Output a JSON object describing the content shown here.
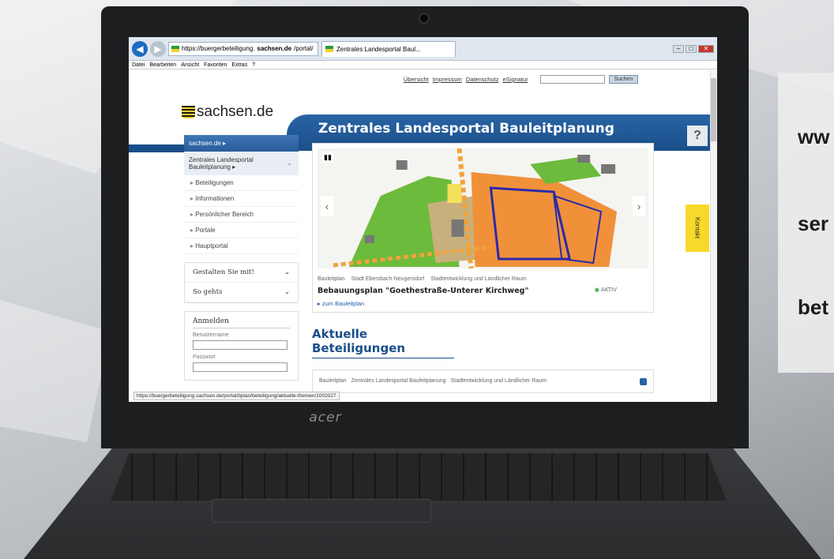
{
  "browser": {
    "url_prefix": "https://buergerbeteiligung.",
    "url_domain": "sachsen.de",
    "url_suffix": "/portal/",
    "tab_title": "Zentrales Landesportal Baul...",
    "menu": [
      "Datei",
      "Bearbeiten",
      "Ansicht",
      "Favoriten",
      "Extras",
      "?"
    ],
    "status_url": "https://buergerbeteiligung.sachsen.de/portal/bplan/beteiligung/aktuelle-themen/1002027"
  },
  "toplinks": [
    "Übersicht",
    "Impressum",
    "Datenschutz",
    "eSignatur"
  ],
  "search_button": "Suchen",
  "header": {
    "logo": "sachsen.de",
    "title": "Zentrales Landesportal Bauleitplanung",
    "help": "?"
  },
  "sidebar": {
    "head": "sachsen.de ▸",
    "sub": "Zentrales Landesportal Bauleitplanung ▸",
    "items": [
      "Beteiligungen",
      "Informationen",
      "Persönlicher Bereich",
      "Portale",
      "Hauptportal"
    ],
    "boxes": [
      "Gestalten Sie mit!",
      "So gehts"
    ],
    "login_title": "Anmelden",
    "username_label": "Benutzername",
    "password_label": "Passwort"
  },
  "feature": {
    "meta_type": "Bauleitplan",
    "meta_city": "Stadt Ebersbach-Neugersdorf",
    "meta_topic": "Stadtentwicklung und Ländlicher Raum",
    "title": "Bebauungsplan \"Goethestraße-Unterer Kirchweg\"",
    "status": "AKTIV",
    "link": "zum Bauleitplan"
  },
  "section_title": "Aktuelle Beteiligungen",
  "card2": {
    "meta_type": "Bauleitplan",
    "meta_org": "Zentrales Landesportal Bauleitplanung",
    "meta_topic": "Stadtentwicklung und Ländlicher Raum"
  },
  "kontakt": "Kontakt",
  "laptop_brand": "acer",
  "overlay_lines": [
    "ww",
    "ser",
    "bet"
  ]
}
